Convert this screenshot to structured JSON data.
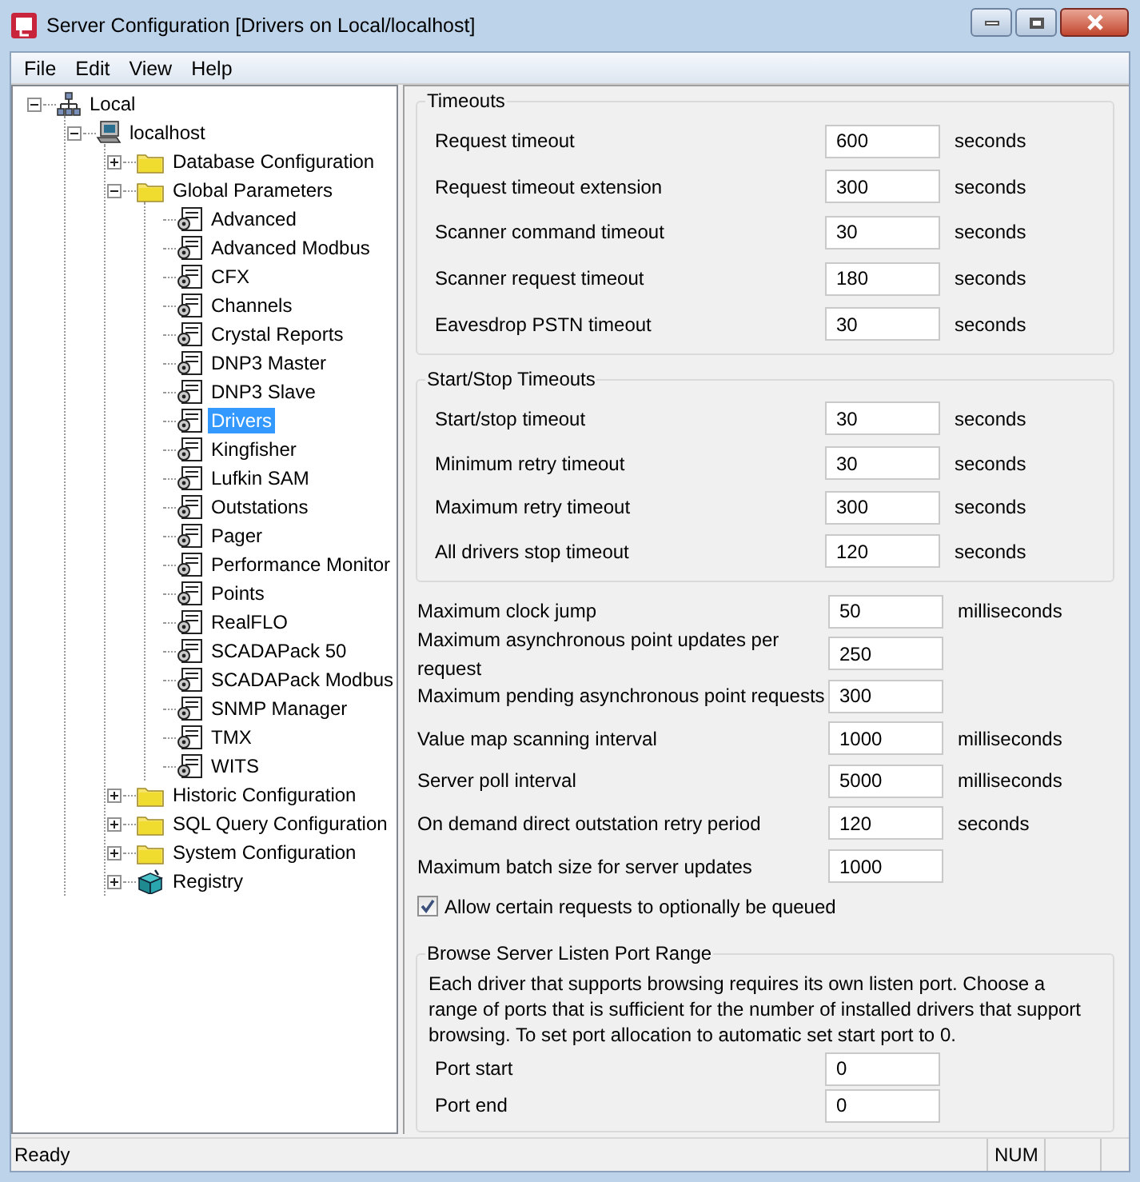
{
  "window": {
    "title": "Server Configuration [Drivers on Local/localhost]"
  },
  "menu": [
    "File",
    "Edit",
    "View",
    "Help"
  ],
  "tree": [
    {
      "label": "Local",
      "kind": "network",
      "expanded": true,
      "selected": false,
      "children": [
        {
          "label": "localhost",
          "kind": "computer",
          "expanded": true,
          "selected": false,
          "children": [
            {
              "label": "Database Configuration",
              "kind": "folder",
              "expanded": false,
              "selected": false
            },
            {
              "label": "Global Parameters",
              "kind": "folder",
              "expanded": true,
              "selected": false,
              "children": [
                {
                  "label": "Advanced",
                  "kind": "settings",
                  "selected": false
                },
                {
                  "label": "Advanced Modbus",
                  "kind": "settings",
                  "selected": false
                },
                {
                  "label": "CFX",
                  "kind": "settings",
                  "selected": false
                },
                {
                  "label": "Channels",
                  "kind": "settings",
                  "selected": false
                },
                {
                  "label": "Crystal Reports",
                  "kind": "settings",
                  "selected": false
                },
                {
                  "label": "DNP3 Master",
                  "kind": "settings",
                  "selected": false
                },
                {
                  "label": "DNP3 Slave",
                  "kind": "settings",
                  "selected": false
                },
                {
                  "label": "Drivers",
                  "kind": "settings",
                  "selected": true
                },
                {
                  "label": "Kingfisher",
                  "kind": "settings",
                  "selected": false
                },
                {
                  "label": "Lufkin SAM",
                  "kind": "settings",
                  "selected": false
                },
                {
                  "label": "Outstations",
                  "kind": "settings",
                  "selected": false
                },
                {
                  "label": "Pager",
                  "kind": "settings",
                  "selected": false
                },
                {
                  "label": "Performance Monitor",
                  "kind": "settings",
                  "selected": false
                },
                {
                  "label": "Points",
                  "kind": "settings",
                  "selected": false
                },
                {
                  "label": "RealFLO",
                  "kind": "settings",
                  "selected": false
                },
                {
                  "label": "SCADAPack 50",
                  "kind": "settings",
                  "selected": false
                },
                {
                  "label": "SCADAPack Modbus",
                  "kind": "settings",
                  "selected": false
                },
                {
                  "label": "SNMP Manager",
                  "kind": "settings",
                  "selected": false
                },
                {
                  "label": "TMX",
                  "kind": "settings",
                  "selected": false
                },
                {
                  "label": "WITS",
                  "kind": "settings",
                  "selected": false
                }
              ]
            },
            {
              "label": "Historic Configuration",
              "kind": "folder",
              "expanded": false,
              "selected": false
            },
            {
              "label": "SQL Query Configuration",
              "kind": "folder",
              "expanded": false,
              "selected": false
            },
            {
              "label": "System Configuration",
              "kind": "folder",
              "expanded": false,
              "selected": false
            },
            {
              "label": "Registry",
              "kind": "registry",
              "expanded": false,
              "selected": false
            }
          ]
        }
      ]
    }
  ],
  "timeouts": {
    "title": "Timeouts",
    "rows": [
      {
        "label": "Request timeout",
        "value": "600",
        "unit": "seconds"
      },
      {
        "label": "Request timeout extension",
        "value": "300",
        "unit": "seconds"
      },
      {
        "label": "Scanner command timeout",
        "value": "30",
        "unit": "seconds"
      },
      {
        "label": "Scanner request timeout",
        "value": "180",
        "unit": "seconds"
      },
      {
        "label": "Eavesdrop PSTN timeout",
        "value": "30",
        "unit": "seconds"
      }
    ]
  },
  "start_stop": {
    "title": "Start/Stop Timeouts",
    "rows": [
      {
        "label": "Start/stop timeout",
        "value": "30",
        "unit": "seconds"
      },
      {
        "label": "Minimum retry timeout",
        "value": "30",
        "unit": "seconds"
      },
      {
        "label": "Maximum retry timeout",
        "value": "300",
        "unit": "seconds"
      },
      {
        "label": "All drivers stop timeout",
        "value": "120",
        "unit": "seconds"
      }
    ]
  },
  "settings": [
    {
      "label": "Maximum clock jump",
      "value": "50",
      "unit": "milliseconds"
    },
    {
      "label": "Maximum asynchronous point updates per request",
      "value": "250"
    },
    {
      "label": "Maximum pending asynchronous point requests",
      "value": "300"
    },
    {
      "label": "Value map scanning interval",
      "value": "1000",
      "unit": "milliseconds"
    },
    {
      "label": "Server poll interval",
      "value": "5000",
      "unit": "milliseconds"
    },
    {
      "label": "On demand direct outstation retry period",
      "value": "120",
      "unit": "seconds"
    },
    {
      "label": "Maximum batch size for server updates",
      "value": "1000"
    }
  ],
  "queue_option": {
    "label": "Allow certain requests to optionally be queued",
    "checked": true
  },
  "browse_ports": {
    "title": "Browse Server Listen Port Range",
    "description": "Each driver that supports browsing requires its own listen port. Choose a range of ports that is sufficient for the number of installed drivers that support browsing. To set port allocation to automatic set start port to 0.",
    "rows": [
      {
        "label": "Port start",
        "value": "0"
      },
      {
        "label": "Port end",
        "value": "0"
      }
    ]
  },
  "status_bar": {
    "message": "Ready",
    "num": "NUM"
  }
}
